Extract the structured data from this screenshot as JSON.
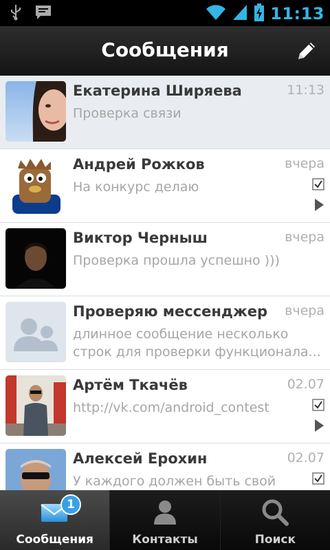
{
  "status_bar": {
    "time": "11:13",
    "icons": [
      "usb-icon",
      "chat-notification-icon",
      "wifi-icon",
      "signal-icon",
      "battery-charging-icon"
    ]
  },
  "header": {
    "title": "Сообщения",
    "compose_icon": "pencil-icon"
  },
  "conversations": [
    {
      "name": "Екатерина Ширяева",
      "time": "11:13",
      "message": "Проверка связи",
      "read_check": false,
      "has_play": false,
      "selected": true
    },
    {
      "name": "Андрей Рожков",
      "time": "вчера",
      "message": "На конкурс делаю",
      "read_check": true,
      "has_play": true,
      "selected": false
    },
    {
      "name": "Виктор Черныш",
      "time": "вчера",
      "message": "Проверка прошла успешно )))",
      "read_check": false,
      "has_play": false,
      "selected": false
    },
    {
      "name": "Проверяю мессенджер",
      "time": "вчера",
      "message": "длинное сообщение несколько строк для проверки функционала...",
      "read_check": false,
      "has_play": false,
      "selected": false
    },
    {
      "name": "Артём Ткачёв",
      "time": "02.07",
      "message": "http://vk.com/android_contest",
      "read_check": true,
      "has_play": true,
      "selected": false
    },
    {
      "name": "Алексей Ерохин",
      "time": "02.07",
      "message": "У каждого должен быть свой",
      "read_check": true,
      "has_play": false,
      "selected": false
    }
  ],
  "bottom_nav": {
    "tabs": [
      {
        "label": "Сообщения",
        "icon": "envelope-icon",
        "badge": "1",
        "active": true
      },
      {
        "label": "Контакты",
        "icon": "person-icon",
        "active": false
      },
      {
        "label": "Поиск",
        "icon": "search-icon",
        "active": false
      }
    ]
  },
  "colors": {
    "accent": "#33b5e5",
    "badge": "#3aa0e6",
    "selected_row": "#e9edf2"
  }
}
